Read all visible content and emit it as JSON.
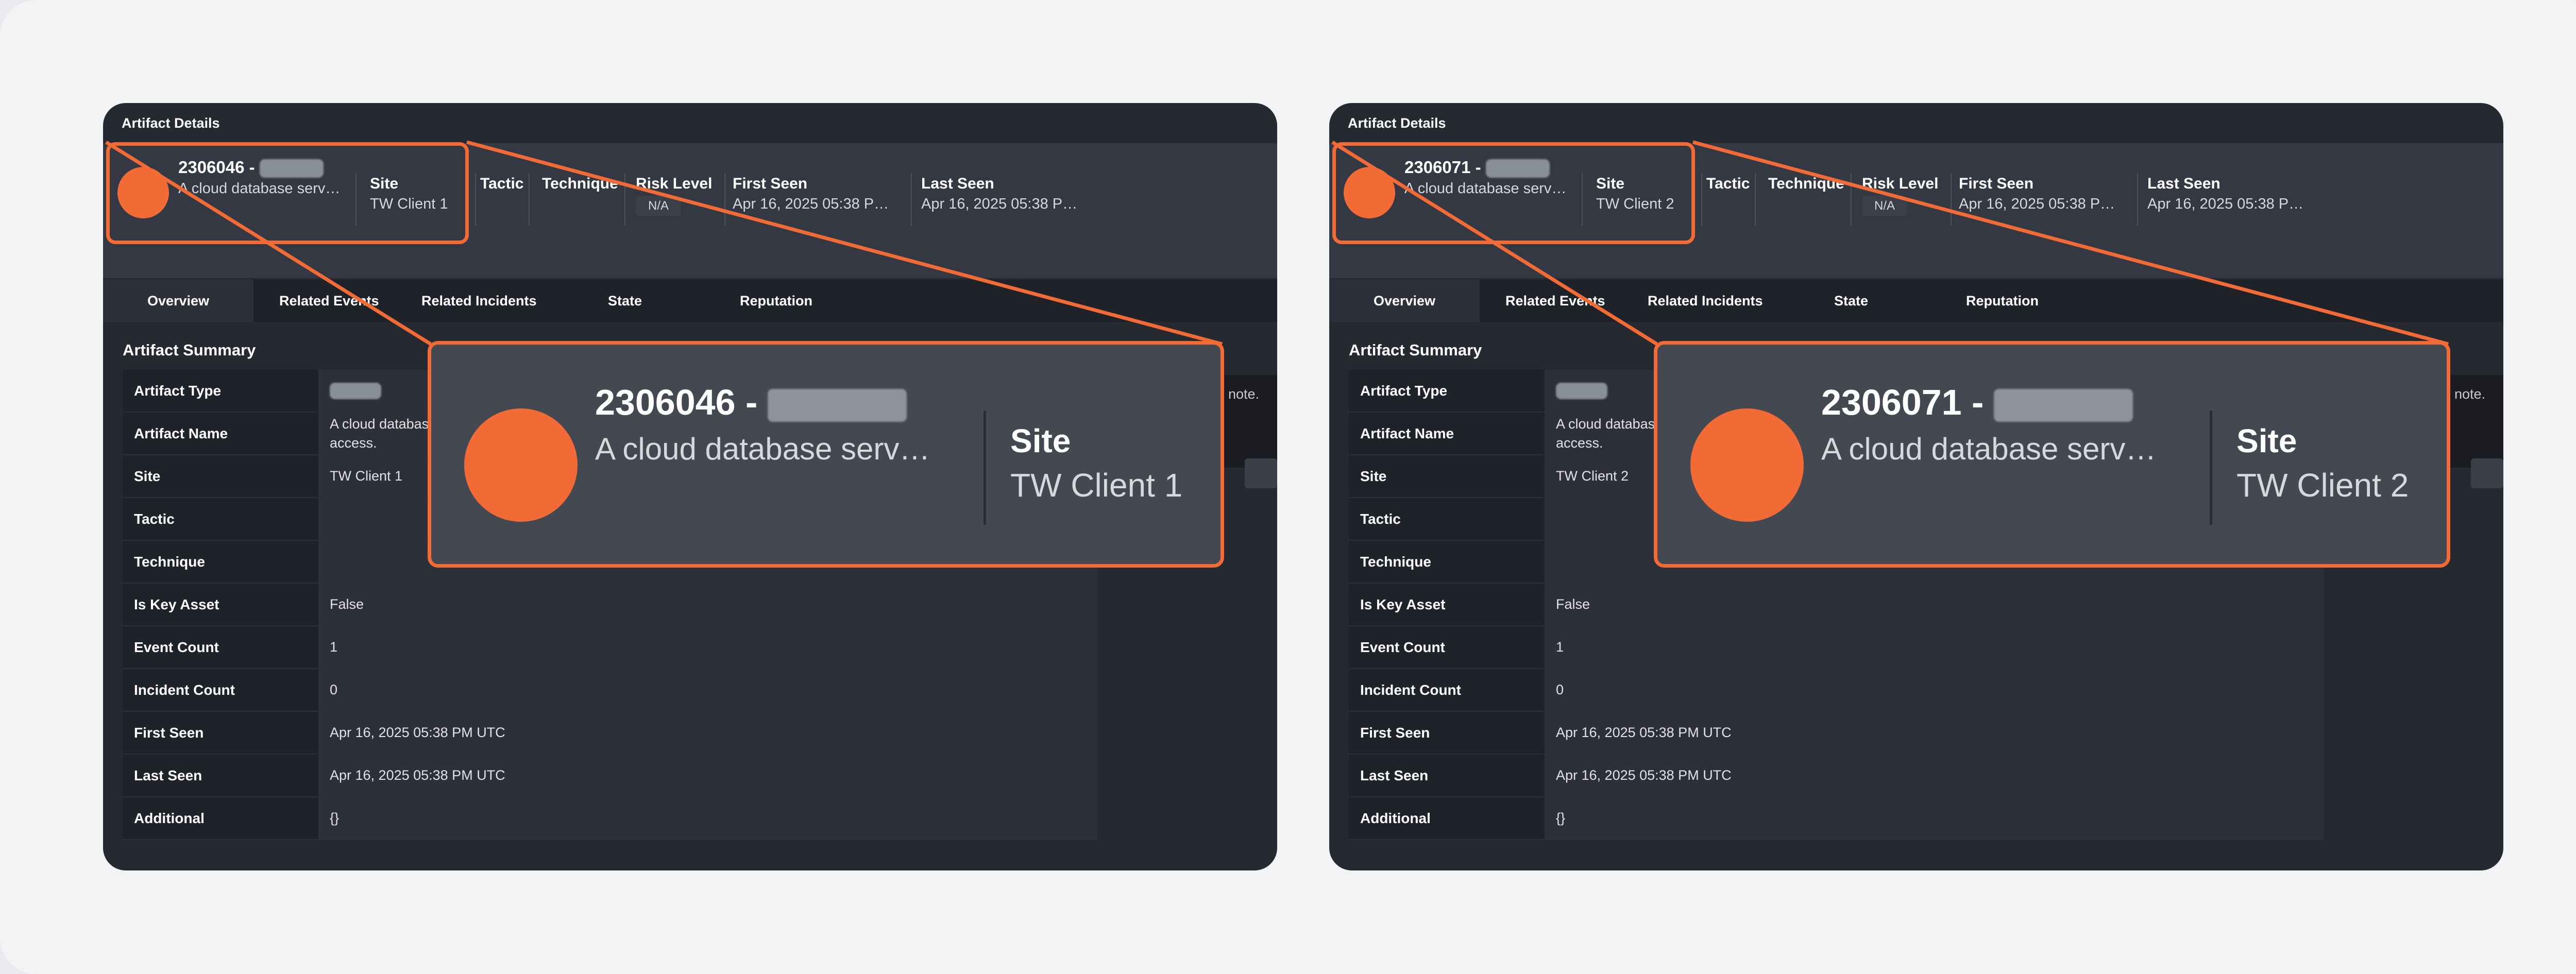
{
  "panels": [
    {
      "window_title": "Artifact Details",
      "header": {
        "artifact_id": "2306046 -",
        "description": "A cloud database serv…",
        "site_label": "Site",
        "site_value": "TW Client 1",
        "tactic_label": "Tactic",
        "technique_label": "Technique",
        "risk_label": "Risk Level",
        "risk_value": "N/A",
        "first_seen_label": "First Seen",
        "first_seen_value": "Apr 16, 2025 05:38 P…",
        "last_seen_label": "Last Seen",
        "last_seen_value": "Apr 16, 2025 05:38 P…"
      },
      "tabs": [
        "Overview",
        "Related Events",
        "Related Incidents",
        "State",
        "Reputation"
      ],
      "active_tab": "Overview",
      "section_title": "Artifact Summary",
      "summary": [
        {
          "key": "Artifact Type",
          "value": ""
        },
        {
          "key": "Artifact Name",
          "value": "A cloud databas",
          "value2": "access."
        },
        {
          "key": "Site",
          "value": "TW Client 1"
        },
        {
          "key": "Tactic",
          "value": ""
        },
        {
          "key": "Technique",
          "value": ""
        },
        {
          "key": "Is Key Asset",
          "value": "False"
        },
        {
          "key": "Event Count",
          "value": "1"
        },
        {
          "key": "Incident Count",
          "value": "0"
        },
        {
          "key": "First Seen",
          "value": "Apr 16, 2025 05:38 PM UTC"
        },
        {
          "key": "Last Seen",
          "value": "Apr 16, 2025 05:38 PM UTC"
        },
        {
          "key": "Additional",
          "value": "{}"
        }
      ],
      "side_note": "note.",
      "zoom": {
        "artifact_id": "2306046 -",
        "description": "A cloud database serv…",
        "site_label": "Site",
        "site_value": "TW Client 1"
      }
    },
    {
      "window_title": "Artifact Details",
      "header": {
        "artifact_id": "2306071 -",
        "description": "A cloud database serv…",
        "site_label": "Site",
        "site_value": "TW Client 2",
        "tactic_label": "Tactic",
        "technique_label": "Technique",
        "risk_label": "Risk Level",
        "risk_value": "N/A",
        "first_seen_label": "First Seen",
        "first_seen_value": "Apr 16, 2025 05:38 P…",
        "last_seen_label": "Last Seen",
        "last_seen_value": "Apr 16, 2025 05:38 P…"
      },
      "tabs": [
        "Overview",
        "Related Events",
        "Related Incidents",
        "State",
        "Reputation"
      ],
      "active_tab": "Overview",
      "section_title": "Artifact Summary",
      "summary": [
        {
          "key": "Artifact Type",
          "value": ""
        },
        {
          "key": "Artifact Name",
          "value": "A cloud databas",
          "value2": "access."
        },
        {
          "key": "Site",
          "value": "TW Client 2"
        },
        {
          "key": "Tactic",
          "value": ""
        },
        {
          "key": "Technique",
          "value": ""
        },
        {
          "key": "Is Key Asset",
          "value": "False"
        },
        {
          "key": "Event Count",
          "value": "1"
        },
        {
          "key": "Incident Count",
          "value": "0"
        },
        {
          "key": "First Seen",
          "value": "Apr 16, 2025 05:38 PM UTC"
        },
        {
          "key": "Last Seen",
          "value": "Apr 16, 2025 05:38 PM UTC"
        },
        {
          "key": "Additional",
          "value": "{}"
        }
      ],
      "side_note": "note.",
      "zoom": {
        "artifact_id": "2306071 -",
        "description": "A cloud database serv…",
        "site_label": "Site",
        "site_value": "TW Client 2"
      }
    }
  ],
  "colors": {
    "accent": "#f26a35",
    "panel_bg": "#262930",
    "header_bg": "#343842",
    "page_bg": "#f2f3f5"
  },
  "icons": {
    "avatar": "orange-circle-avatar-icon",
    "redaction": "blurred-text-redaction"
  }
}
